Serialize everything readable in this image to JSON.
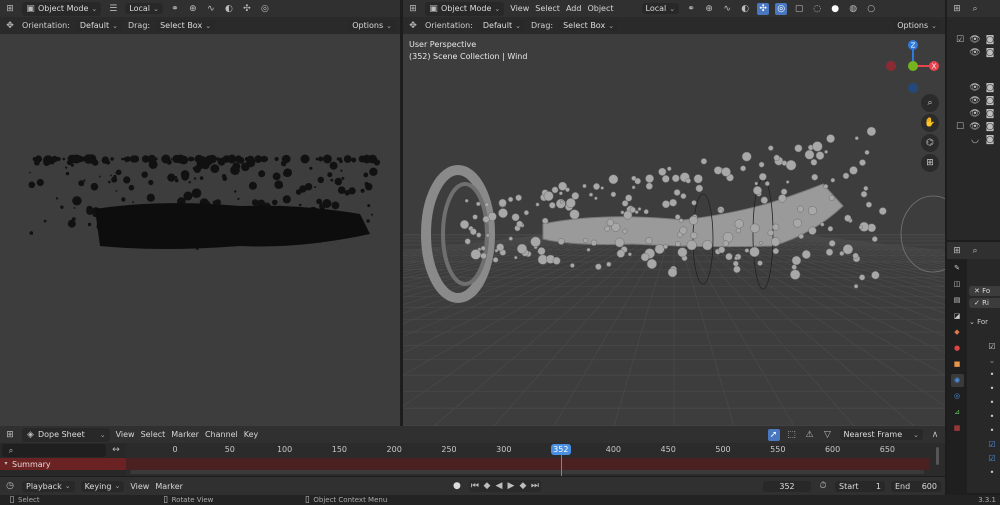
{
  "left_viewport": {
    "header": {
      "mode": "Object Mode",
      "transform_space": "Local",
      "icons": [
        "editor-type-icon",
        "hamburger-icon",
        "link-icon",
        "proportional-icon",
        "snap-icon",
        "overlay-icon",
        "shading-icon"
      ]
    },
    "toolbar": {
      "orientation_label": "Orientation:",
      "orientation_value": "Default",
      "drag_label": "Drag:",
      "drag_value": "Select Box",
      "options_label": "Options"
    }
  },
  "right_viewport": {
    "header": {
      "mode": "Object Mode",
      "menus": [
        "View",
        "Select",
        "Add",
        "Object"
      ],
      "transform_space": "Local"
    },
    "toolbar": {
      "orientation_label": "Orientation:",
      "orientation_value": "Default",
      "drag_label": "Drag:",
      "drag_value": "Select Box",
      "options_label": "Options"
    },
    "overlay": {
      "perspective": "User Perspective",
      "collection": "(352) Scene Collection | Wind"
    },
    "gizmo": {
      "x_label": "X",
      "y_label": "Y",
      "z_label": "Z",
      "colors": {
        "x": "#e8444f",
        "y": "#74b51f",
        "z": "#2e7bdc"
      }
    }
  },
  "dopesheet": {
    "header": {
      "editor": "Dope Sheet",
      "menus": [
        "View",
        "Select",
        "Marker",
        "Channel",
        "Key"
      ],
      "snapping": "Nearest Frame"
    },
    "summary_label": "Summary",
    "ticks": [
      0,
      50,
      100,
      150,
      200,
      250,
      300,
      350,
      400,
      450,
      500,
      550,
      600,
      650
    ],
    "current_frame_badge": "352",
    "current_frame": 352
  },
  "timeline": {
    "menus": [
      "Playback",
      "Keying",
      "View",
      "Marker"
    ],
    "current_frame": "352",
    "start_label": "Start",
    "start_value": "1",
    "end_label": "End",
    "end_value": "600"
  },
  "statusbar": {
    "select": "Select",
    "rotate": "Rotate View",
    "context": "Object Context Menu",
    "version": "3.3.1"
  },
  "properties": {
    "items": [
      "Fo",
      "Ri"
    ],
    "section": "For"
  },
  "colors": {
    "summary_bar": "#6b2222",
    "playhead": "#4a90e2",
    "viewport_bg": "#3d3d3d",
    "header_bg": "#303030"
  }
}
